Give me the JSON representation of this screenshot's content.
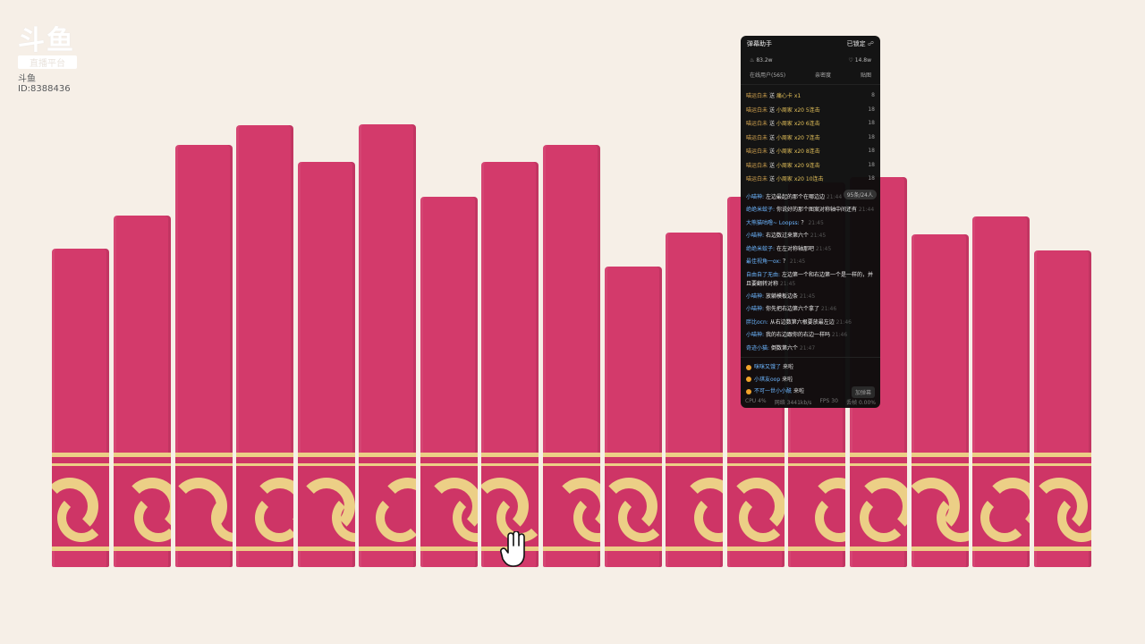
{
  "watermark": {
    "brand": "斗鱼",
    "sub": "直播平台",
    "room_id": "斗鱼ID:8388436"
  },
  "colors": {
    "background": "#f6efe7",
    "book": "#d33a6b",
    "ornament": "#eccf86",
    "panel": "#0c0c0c"
  },
  "panel": {
    "title": "弹幕助手",
    "locked_label": "已锁定",
    "stats": {
      "hot": "83.2w",
      "likes": "14.8w"
    },
    "tabs": [
      "在线用户(565)",
      "亲密度",
      "贴图"
    ],
    "gifts": [
      {
        "user": "喵运白未",
        "verb": "送",
        "gift": "痛心卡",
        "qty": "x1",
        "count": "8"
      },
      {
        "user": "喵运白未",
        "verb": "送",
        "gift": "小周家",
        "qty": "x20 5连击",
        "count": "18"
      },
      {
        "user": "喵运白未",
        "verb": "送",
        "gift": "小周家",
        "qty": "x20 6连击",
        "count": "18"
      },
      {
        "user": "喵运白未",
        "verb": "送",
        "gift": "小周家",
        "qty": "x20 7连击",
        "count": "18"
      },
      {
        "user": "喵运白未",
        "verb": "送",
        "gift": "小周家",
        "qty": "x20 8连击",
        "count": "18"
      },
      {
        "user": "喵运白未",
        "verb": "送",
        "gift": "小周家",
        "qty": "x20 9连击",
        "count": "18"
      },
      {
        "user": "喵运白未",
        "verb": "送",
        "gift": "小周家",
        "qty": "x20 10连击",
        "count": "18"
      }
    ],
    "chat_badge": "95条/24人",
    "chat": [
      {
        "nick": "小喵神:",
        "msg": "左边最起的那个在哪边边",
        "time": "21:44"
      },
      {
        "nick": "绝绝米蚊子:",
        "msg": "你说好的那个图案对称轴中间还有",
        "time": "21:44"
      },
      {
        "nick": "大熊猫咕噜~ Loopss:",
        "msg": "？",
        "time": "21:45"
      },
      {
        "nick": "小喵神:",
        "msg": "右边数过来第六个",
        "time": "21:45"
      },
      {
        "nick": "绝绝米蚊子:",
        "msg": "在左对称轴那吧",
        "time": "21:45"
      },
      {
        "nick": "最佳视角一ox:",
        "msg": "？",
        "time": "21:45"
      },
      {
        "nick": "自由自了无由:",
        "msg": "左边第一个和右边第一个是一样的，并且要翻转对称",
        "time": "21:45"
      },
      {
        "nick": "小喵神:",
        "msg": "放躺模板边条",
        "time": "21:45"
      },
      {
        "nick": "小喵神:",
        "msg": "你先把右边第六个拿了",
        "time": "21:46"
      },
      {
        "nick": "胖比ocn:",
        "msg": "从右边数第六根要放最左边",
        "time": "21:46"
      },
      {
        "nick": "小喵神:",
        "msg": "我的右边跟你的右边一样吗",
        "time": "21:46"
      },
      {
        "nick": "奇迹小猫:",
        "msg": "倒数第六个",
        "time": "21:47"
      }
    ],
    "enter": [
      {
        "nick": "咪咪又饿了",
        "msg": "来啦"
      },
      {
        "nick": "小琪友oop",
        "msg": "来啦"
      },
      {
        "nick": "不可一世小小酰",
        "msg": "来啦"
      }
    ],
    "enter_button": "加弹幕",
    "footer": {
      "cpu": "CPU 4%",
      "net": "网络 3441kb/s",
      "fps": "FPS 30",
      "drop": "丢帧 0.00%"
    }
  }
}
